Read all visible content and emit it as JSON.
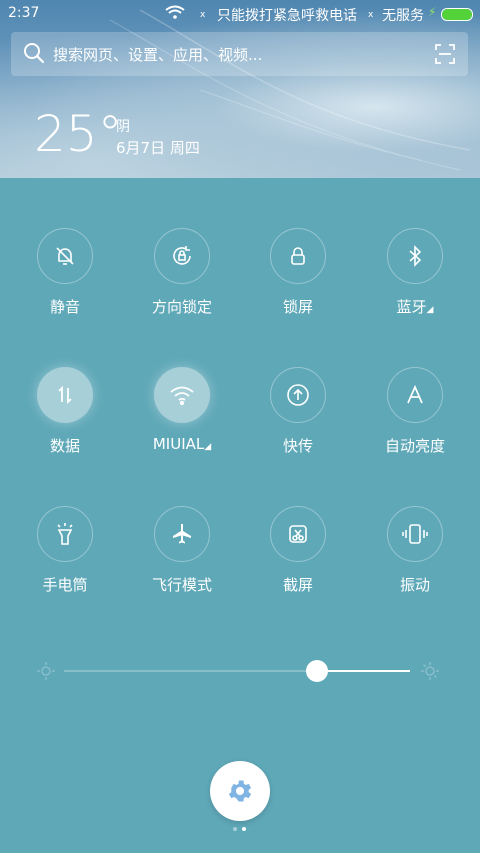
{
  "status_bar": {
    "time": "2:37",
    "emergency": "只能拨打紧急呼救电话",
    "no_service": "无服务",
    "x_mark": "x",
    "battery_level": 1.0,
    "battery_color": "#53d23a"
  },
  "search": {
    "placeholder": "搜索网页、设置、应用、视频..."
  },
  "weather": {
    "temperature": "25°",
    "condition": "阴",
    "date": "6月7日 周四"
  },
  "toggles": [
    {
      "label": "静音",
      "icon": "silent-bell-icon",
      "active": false
    },
    {
      "label": "方向锁定",
      "icon": "rotation-lock-icon",
      "active": false
    },
    {
      "label": "锁屏",
      "icon": "lock-icon",
      "active": false
    },
    {
      "label": "蓝牙",
      "icon": "bluetooth-icon",
      "active": false,
      "has_menu": true
    },
    {
      "label": "数据",
      "icon": "mobile-data-icon",
      "active": true
    },
    {
      "label": "MIUIAL",
      "icon": "wifi-icon",
      "active": true,
      "has_menu": true
    },
    {
      "label": "快传",
      "icon": "quick-transfer-icon",
      "active": false
    },
    {
      "label": "自动亮度",
      "icon": "auto-brightness-icon",
      "active": false
    },
    {
      "label": "手电筒",
      "icon": "flashlight-icon",
      "active": false
    },
    {
      "label": "飞行模式",
      "icon": "airplane-icon",
      "active": false
    },
    {
      "label": "截屏",
      "icon": "screenshot-icon",
      "active": false
    },
    {
      "label": "振动",
      "icon": "vibrate-icon",
      "active": false
    }
  ],
  "brightness": {
    "level": 0.73
  },
  "pager": {
    "current": 2,
    "total": 2
  },
  "colors": {
    "panel_bg": "#5fa8b8",
    "settings_gear": "#7fb4e3"
  }
}
